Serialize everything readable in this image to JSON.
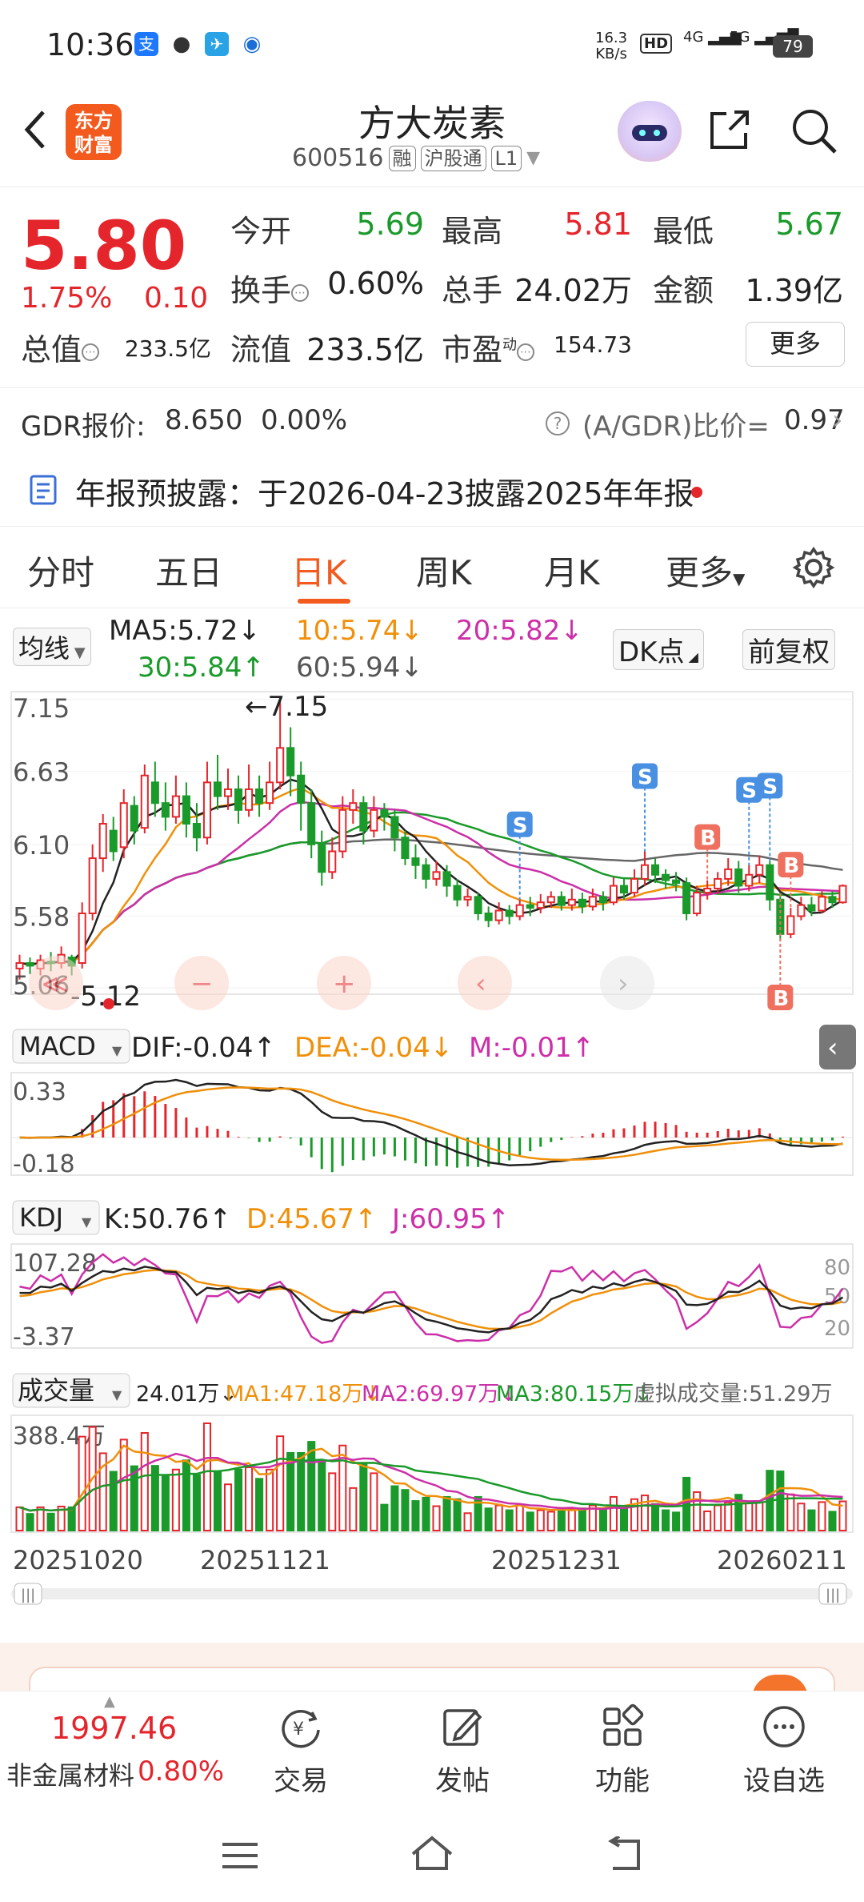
{
  "status_bar": {
    "time": "10:36",
    "net_speed": "16.3",
    "net_unit": "KB/s",
    "hd": "HD",
    "sig1": "4G",
    "sig2": "5G",
    "battery": "79"
  },
  "header": {
    "logo_line1": "东方",
    "logo_line2": "财富",
    "stock_name": "方大炭素",
    "stock_code": "600516",
    "tags": [
      "融",
      "沪股通",
      "L1"
    ]
  },
  "quote": {
    "price": "5.80",
    "change_pct": "1.75%",
    "change": "0.10",
    "open_label": "今开",
    "open": "5.69",
    "high_label": "最高",
    "high": "5.81",
    "low_label": "最低",
    "low": "5.67",
    "turnover_label": "换手",
    "turnover": "0.60%",
    "volume_label": "总手",
    "volume": "24.02万",
    "amount_label": "金额",
    "amount": "1.39亿",
    "mktcap_label": "总值",
    "mktcap": "233.5亿",
    "float_label": "流值",
    "float_cap": "233.5亿",
    "pe_label": "市盈",
    "pe_sup": "动",
    "pe": "154.73",
    "more": "更多"
  },
  "gdr": {
    "label": "GDR报价:",
    "price": "8.650",
    "pct": "0.00%",
    "ratio_label": "(A/GDR)比价=",
    "ratio": "0.97"
  },
  "notice": {
    "text": "年报预披露：于2026-04-23披露2025年年报"
  },
  "tabs": [
    "分时",
    "五日",
    "日K",
    "周K",
    "月K",
    "更多"
  ],
  "ma_row": {
    "selector": "均线",
    "ma5": "MA5:5.72↓",
    "ma10": "10:5.74↓",
    "ma20": "20:5.82↓",
    "ma30": "30:5.84↑",
    "ma60": "60:5.94↓",
    "dk": "DK点",
    "adjust": "前复权"
  },
  "chart_data": {
    "type": "candlestick",
    "y_ticks": [
      "7.15",
      "6.63",
      "6.10",
      "5.58",
      "5.06"
    ],
    "high_marker": "7.15",
    "low_marker": "5.12",
    "x_ticks": [
      "20251020",
      "20251121",
      "20251231",
      "20260211"
    ],
    "signals": [
      {
        "label": "S",
        "color": "#4a90e2"
      },
      {
        "label": "S",
        "color": "#4a90e2"
      },
      {
        "label": "B",
        "color": "#f07060"
      },
      {
        "label": "S",
        "color": "#4a90e2"
      },
      {
        "label": "S",
        "color": "#4a90e2"
      },
      {
        "label": "B",
        "color": "#f07060"
      },
      {
        "label": "B",
        "color": "#f07060"
      }
    ],
    "ylim": [
      5.06,
      7.15
    ],
    "candles": [
      [
        5.2,
        5.24,
        5.12,
        5.3
      ],
      [
        5.24,
        5.22,
        5.16,
        5.28
      ],
      [
        5.2,
        5.26,
        5.15,
        5.3
      ],
      [
        5.25,
        5.24,
        5.18,
        5.32
      ],
      [
        5.24,
        5.3,
        5.2,
        5.36
      ],
      [
        5.28,
        5.22,
        5.15,
        5.3
      ],
      [
        5.24,
        5.6,
        5.2,
        5.68
      ],
      [
        5.6,
        6.0,
        5.55,
        6.1
      ],
      [
        6.0,
        6.25,
        5.9,
        6.32
      ],
      [
        6.2,
        6.05,
        5.98,
        6.3
      ],
      [
        6.08,
        6.4,
        6.0,
        6.5
      ],
      [
        6.38,
        6.2,
        6.1,
        6.45
      ],
      [
        6.22,
        6.6,
        6.18,
        6.68
      ],
      [
        6.55,
        6.4,
        6.3,
        6.7
      ],
      [
        6.4,
        6.3,
        6.2,
        6.55
      ],
      [
        6.3,
        6.45,
        6.25,
        6.6
      ],
      [
        6.45,
        6.25,
        6.15,
        6.55
      ],
      [
        6.25,
        6.15,
        6.05,
        6.4
      ],
      [
        6.15,
        6.55,
        6.1,
        6.7
      ],
      [
        6.55,
        6.45,
        6.35,
        6.75
      ],
      [
        6.45,
        6.5,
        6.35,
        6.65
      ],
      [
        6.5,
        6.35,
        6.25,
        6.6
      ],
      [
        6.35,
        6.5,
        6.3,
        6.68
      ],
      [
        6.5,
        6.4,
        6.3,
        6.6
      ],
      [
        6.4,
        6.55,
        6.35,
        6.7
      ],
      [
        6.55,
        6.8,
        6.5,
        7.15
      ],
      [
        6.8,
        6.6,
        6.45,
        6.95
      ],
      [
        6.6,
        6.4,
        6.2,
        6.7
      ],
      [
        6.4,
        6.1,
        6.0,
        6.5
      ],
      [
        6.1,
        5.9,
        5.8,
        6.2
      ],
      [
        5.9,
        6.05,
        5.85,
        6.15
      ],
      [
        6.05,
        6.35,
        6.0,
        6.45
      ],
      [
        6.35,
        6.4,
        6.25,
        6.5
      ],
      [
        6.4,
        6.2,
        6.1,
        6.45
      ],
      [
        6.2,
        6.35,
        6.15,
        6.45
      ],
      [
        6.35,
        6.3,
        6.2,
        6.4
      ],
      [
        6.3,
        6.15,
        6.05,
        6.35
      ],
      [
        6.15,
        6.0,
        5.95,
        6.2
      ],
      [
        6.0,
        5.95,
        5.85,
        6.1
      ],
      [
        5.95,
        5.85,
        5.78,
        6.0
      ],
      [
        5.85,
        5.9,
        5.8,
        5.98
      ],
      [
        5.9,
        5.8,
        5.72,
        5.95
      ],
      [
        5.8,
        5.7,
        5.65,
        5.85
      ],
      [
        5.7,
        5.72,
        5.65,
        5.78
      ],
      [
        5.72,
        5.6,
        5.55,
        5.75
      ],
      [
        5.6,
        5.55,
        5.5,
        5.65
      ],
      [
        5.55,
        5.62,
        5.52,
        5.68
      ],
      [
        5.62,
        5.58,
        5.52,
        5.66
      ],
      [
        5.58,
        5.66,
        5.55,
        5.7
      ],
      [
        5.66,
        5.64,
        5.58,
        5.72
      ],
      [
        5.64,
        5.68,
        5.6,
        5.74
      ],
      [
        5.68,
        5.72,
        5.64,
        5.76
      ],
      [
        5.72,
        5.66,
        5.62,
        5.76
      ],
      [
        5.66,
        5.7,
        5.62,
        5.78
      ],
      [
        5.7,
        5.65,
        5.6,
        5.75
      ],
      [
        5.65,
        5.72,
        5.62,
        5.78
      ],
      [
        5.72,
        5.68,
        5.62,
        5.76
      ],
      [
        5.68,
        5.8,
        5.66,
        5.86
      ],
      [
        5.8,
        5.75,
        5.7,
        5.85
      ],
      [
        5.75,
        5.85,
        5.72,
        5.92
      ],
      [
        5.85,
        5.95,
        5.8,
        6.05
      ],
      [
        5.95,
        5.88,
        5.82,
        6.0
      ],
      [
        5.88,
        5.84,
        5.78,
        5.92
      ],
      [
        5.84,
        5.82,
        5.76,
        5.9
      ],
      [
        5.82,
        5.6,
        5.55,
        5.86
      ],
      [
        5.6,
        5.75,
        5.58,
        5.8
      ],
      [
        5.75,
        5.78,
        5.7,
        5.84
      ],
      [
        5.78,
        5.85,
        5.74,
        5.9
      ],
      [
        5.85,
        5.92,
        5.8,
        6.0
      ],
      [
        5.92,
        5.8,
        5.75,
        5.98
      ],
      [
        5.8,
        5.88,
        5.76,
        5.95
      ],
      [
        5.88,
        5.95,
        5.82,
        6.02
      ],
      [
        5.95,
        5.7,
        5.62,
        5.98
      ],
      [
        5.7,
        5.45,
        5.4,
        5.75
      ],
      [
        5.45,
        5.58,
        5.42,
        5.64
      ],
      [
        5.58,
        5.66,
        5.55,
        5.72
      ],
      [
        5.66,
        5.62,
        5.58,
        5.72
      ],
      [
        5.62,
        5.72,
        5.6,
        5.76
      ],
      [
        5.72,
        5.68,
        5.64,
        5.76
      ],
      [
        5.68,
        5.8,
        5.67,
        5.81
      ]
    ]
  },
  "macd_row": {
    "selector": "MACD",
    "dif": "DIF:-0.04↑",
    "dea": "DEA:-0.04↓",
    "m": "M:-0.01↑",
    "y_top": "0.33",
    "y_bottom": "-0.18"
  },
  "kdj_row": {
    "selector": "KDJ",
    "k": "K:50.76↑",
    "d": "D:45.67↑",
    "j": "J:60.95↑",
    "y_top": "107.28",
    "y_bottom": "-3.37",
    "r80": "80",
    "r50": "50",
    "r20": "20"
  },
  "vol_row": {
    "selector": "成交量",
    "vol": "24.01万↓",
    "ma1": "MA1:47.18万↓",
    "ma2": "MA2:69.97万↓",
    "ma3": "MA3:80.15万↓",
    "virtual": "虚拟成交量:51.29万",
    "y_top": "388.4万"
  },
  "bottom_nav": {
    "index_value": "1997.46",
    "index_name": "非金属材料",
    "index_pct": "0.80%",
    "items": [
      "交易",
      "发帖",
      "功能",
      "设自选"
    ]
  },
  "colors": {
    "up": "#e4262c",
    "down": "#1a9a2a",
    "accent": "#f25a1e",
    "ma5": "#222222",
    "ma10": "#f0900a",
    "ma20": "#cc2fa8",
    "ma30": "#1a9a2a",
    "ma60": "#666666"
  }
}
